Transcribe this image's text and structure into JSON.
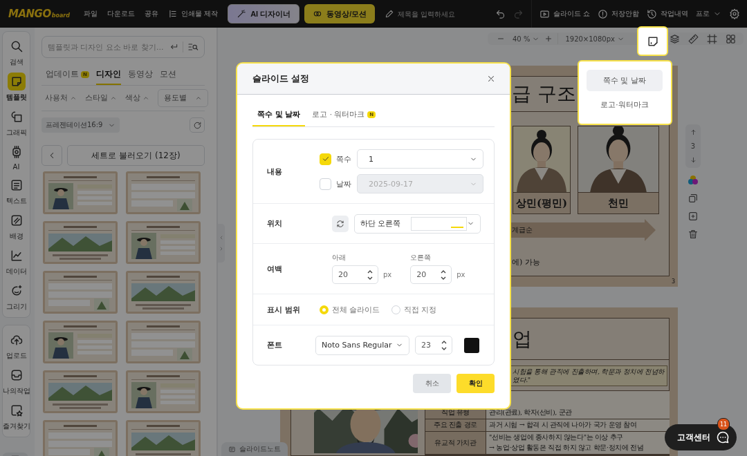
{
  "top_bar": {
    "logo": {
      "main": "MANGO",
      "sub": "board"
    },
    "menu": [
      "파일",
      "다운로드",
      "공유"
    ],
    "print_button": "인쇄물 제작",
    "ai_button": "AI 디자이너",
    "video_button": "동영상/모션",
    "title_field": {
      "placeholder": "제목을 입력하세요"
    },
    "slideshow_button": "슬라이드 쇼",
    "save_status": "저장안함",
    "history_button": "작업내역",
    "plan_menu": "프로"
  },
  "rail": {
    "groups": [
      {
        "items": [
          {
            "kind": "search",
            "label": "검색",
            "selected": false
          },
          {
            "kind": "template",
            "label": "템플릿",
            "selected": true
          },
          {
            "kind": "graphic",
            "label": "그래픽",
            "selected": false
          },
          {
            "kind": "ai",
            "label": "AI",
            "selected": false
          },
          {
            "kind": "text",
            "label": "텍스트",
            "selected": false
          },
          {
            "kind": "background",
            "label": "배경",
            "selected": false
          },
          {
            "kind": "data",
            "label": "데이터",
            "selected": false
          },
          {
            "kind": "draw",
            "label": "그리기",
            "selected": false
          }
        ]
      },
      {
        "items": [
          {
            "kind": "upload",
            "label": "업로드",
            "selected": false
          },
          {
            "kind": "mywork",
            "label": "나의작업",
            "selected": false
          },
          {
            "kind": "favorite",
            "label": "즐겨찾기",
            "selected": false
          }
        ]
      }
    ]
  },
  "panel": {
    "search": {
      "placeholder": "템플릿과 디자인 요소 바로 찾기..."
    },
    "tabs": [
      {
        "label": "업데이트",
        "badge": "N",
        "selected": false
      },
      {
        "label": "디자인",
        "selected": true
      },
      {
        "label": "동영상",
        "selected": false
      },
      {
        "label": "모션",
        "selected": false
      }
    ],
    "filters": [
      "사용처",
      "스타일",
      "색상"
    ],
    "purpose_select": "용도별",
    "format_select": "프레젠테이션16:9",
    "set_button": "세트로 불러오기 (12장)",
    "templates": [
      {
        "kind": "picture"
      },
      {
        "kind": "picture"
      },
      {
        "kind": "picture"
      },
      {
        "kind": "picture"
      },
      {
        "kind": "picture"
      },
      {
        "kind": "picture"
      },
      {
        "kind": "picture"
      },
      {
        "kind": "picture"
      },
      {
        "kind": "picture"
      },
      {
        "kind": "picture"
      },
      {
        "kind": "picture"
      },
      {
        "kind": "picture"
      }
    ]
  },
  "canvas": {
    "zoom": "40 %",
    "size": "1920×1080px",
    "current_page": "3",
    "slide_1": {
      "title": "급 구조",
      "cards": [
        "상민(평민)",
        "천민"
      ],
      "arrow_label": "계급순",
      "note": "에) 가능",
      "page_number": "3"
    },
    "slide_2": {
      "title": "업",
      "quote": "시험을 통해 관직에 진출하며, 학문과 정치에 전념하였다.\"",
      "table": [
        {
          "label": "직업 유형",
          "lines": [
            "관리(관료), 학자(선비), 군관"
          ]
        },
        {
          "label": "주요 진출 경로",
          "lines": [
            "과거 시험 → 합격 시 관직에 나아가 국가 운영 참여"
          ]
        },
        {
          "label": "유교적 가치관",
          "lines": [
            "\"선비는 생업에 종사하지 않는다\"는 이상 추구",
            "→ 농업·상업 활동은 직접 하지 않고 학문·정치에 전념"
          ]
        }
      ]
    },
    "note_tab": "슬라이드노트"
  },
  "help_button": {
    "label": "고객센터",
    "badge": "11"
  },
  "dialog": {
    "title": "슬라이드 설정",
    "tabs": [
      {
        "label": "쪽수 및 날짜",
        "selected": true
      },
      {
        "label": "로고 · 워터마크",
        "badge": "N",
        "selected": false
      }
    ],
    "content_label": "내용",
    "page_number": {
      "label": "쪽수",
      "checked": true,
      "value": "1"
    },
    "date": {
      "label": "날짜",
      "checked": false,
      "value": "2025-09-17"
    },
    "position_label": "위치",
    "position": {
      "value": "하단 오른쪽"
    },
    "margin_label": "여백",
    "margins": [
      {
        "label": "아래",
        "value": "20",
        "unit": "px"
      },
      {
        "label": "오른쪽",
        "value": "20",
        "unit": "px"
      }
    ],
    "range_label": "표시 범위",
    "range_options": [
      {
        "label": "전체 슬라이드",
        "selected": true
      },
      {
        "label": "직접 지정",
        "selected": false
      }
    ],
    "font_label": "폰트",
    "font": {
      "family": "Noto Sans Regular",
      "size": "23",
      "color": "#111111"
    },
    "buttons": {
      "cancel": "취소",
      "confirm": "확인"
    }
  },
  "popup": {
    "items": [
      {
        "label": "쪽수 및 날짜",
        "selected": true
      },
      {
        "label": "로고·워터마크",
        "selected": false
      }
    ]
  }
}
